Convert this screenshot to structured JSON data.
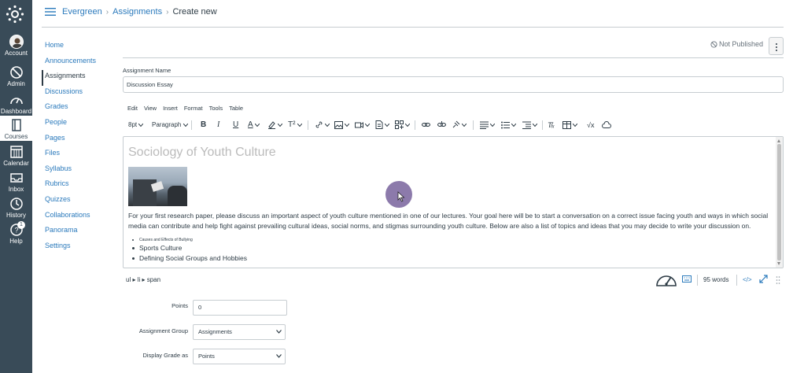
{
  "global_nav": {
    "items": [
      {
        "label": "Account",
        "icon": "avatar-icon"
      },
      {
        "label": "Admin",
        "icon": "shield-icon"
      },
      {
        "label": "Dashboard",
        "icon": "dashboard-icon"
      },
      {
        "label": "Courses",
        "icon": "book-icon"
      },
      {
        "label": "Calendar",
        "icon": "calendar-icon"
      },
      {
        "label": "Inbox",
        "icon": "inbox-icon"
      },
      {
        "label": "History",
        "icon": "clock-icon"
      },
      {
        "label": "Help",
        "icon": "help-icon",
        "badge": "1"
      }
    ],
    "active": "Courses",
    "bg_color": "#394b58"
  },
  "breadcrumb": {
    "course": "Evergreen",
    "section": "Assignments",
    "current": "Create new"
  },
  "course_nav": {
    "items": [
      "Home",
      "Announcements",
      "Assignments",
      "Discussions",
      "Grades",
      "People",
      "Pages",
      "Files",
      "Syllabus",
      "Rubrics",
      "Quizzes",
      "Collaborations",
      "Panorama",
      "Settings"
    ],
    "active": "Assignments"
  },
  "publish_status": "Not Published",
  "assignment": {
    "name_label": "Assignment Name",
    "name_value": "Discussion Essay"
  },
  "editor": {
    "menu": [
      "Edit",
      "View",
      "Insert",
      "Format",
      "Tools",
      "Table"
    ],
    "font_size": "8pt",
    "block_format": "Paragraph",
    "title": "Sociology of Youth Culture",
    "paragraph": "For your first research paper, please discuss an important aspect of youth culture mentioned in one of our lectures. Your goal here will be to start a conversation on a correct issue facing youth and ways in which social media can contribute and help fight against prevailing cultural ideas, social norms, and stigmas surrounding youth culture. Below are also a list of topics and ideas that you may decide to write your discussion on.",
    "list": [
      "Causes and Effects of Bullying",
      "Sports Culture",
      "Defining Social Groups and Hobbies"
    ],
    "path": "ul ▸ li ▸ span",
    "word_count": "95 words",
    "html_toggle": "</>"
  },
  "form": {
    "points_label": "Points",
    "points_value": "0",
    "group_label": "Assignment Group",
    "group_value": "Assignments",
    "display_label": "Display Grade as",
    "display_value": "Points"
  },
  "colors": {
    "link": "#2b7abc",
    "text": "#2d3b45",
    "cursor_highlight": "#6b5494"
  }
}
